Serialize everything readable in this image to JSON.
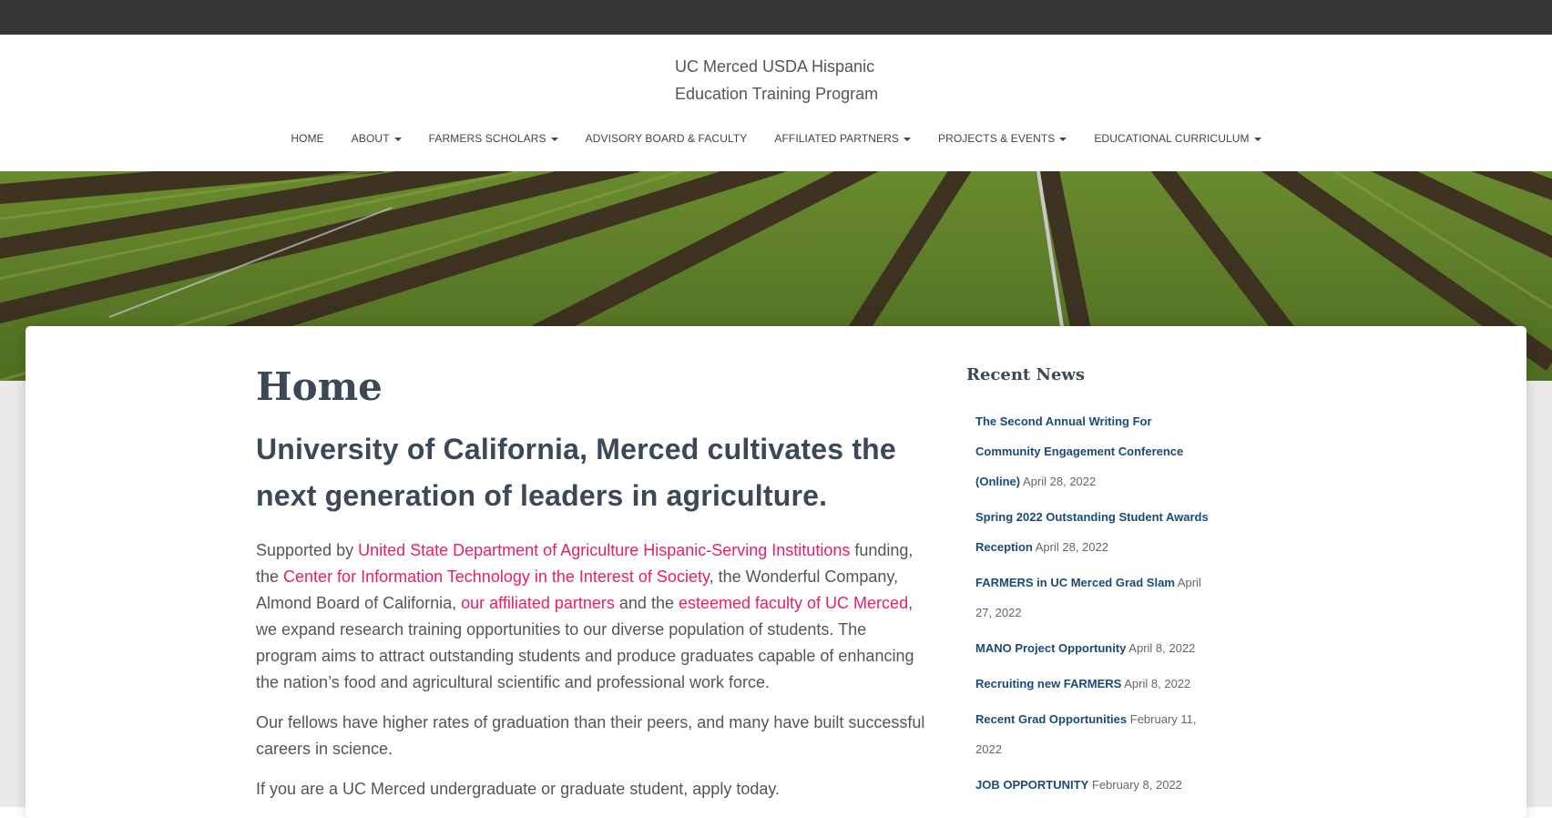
{
  "site": {
    "title_line1": "UC Merced USDA Hispanic",
    "title_line2": "Education Training Program"
  },
  "nav": {
    "items": [
      {
        "label": "HOME",
        "dropdown": false
      },
      {
        "label": "ABOUT",
        "dropdown": true
      },
      {
        "label": "FARMERS SCHOLARS",
        "dropdown": true
      },
      {
        "label": "ADVISORY BOARD & FACULTY",
        "dropdown": false
      },
      {
        "label": "AFFILIATED PARTNERS",
        "dropdown": true
      },
      {
        "label": "PROJECTS & EVENTS",
        "dropdown": true
      },
      {
        "label": "EDUCATIONAL CURRICULUM",
        "dropdown": true
      }
    ]
  },
  "main": {
    "page_title": "Home",
    "headline": "University of California, Merced cultivates the next generation of leaders in agriculture.",
    "p1": {
      "t1": "Supported by ",
      "link1": "United State Department of Agriculture Hispanic-Serving Institutions",
      "t2": " funding, the ",
      "link2": "Center for Information Technology in the Interest of Society",
      "t3": ", the Wonderful Company, Almond Board of California, ",
      "link3": "our affiliated partners",
      "t4": " and the ",
      "link4": "esteemed faculty of UC Merced",
      "t5": ", we expand research training opportunities to our diverse population of students. The program aims to attract outstanding students and produce graduates capable of enhancing the nation’s food and agricultural scientific and professional work force."
    },
    "p2": "Our fellows have higher rates of graduation than their peers, and many have built successful careers in science.",
    "p3": "If you are a UC Merced undergraduate or graduate student, apply today."
  },
  "sidebar": {
    "title": "Recent News",
    "items": [
      {
        "title": "The Second Annual Writing For Community Engagement Conference (Online)",
        "date": "April 28, 2022"
      },
      {
        "title": "Spring 2022 Outstanding Student Awards Reception",
        "date": "April 28, 2022"
      },
      {
        "title": "FARMERS in UC Merced Grad Slam",
        "date": "April 27, 2022"
      },
      {
        "title": "MANO Project Opportunity",
        "date": "April 8, 2022"
      },
      {
        "title": "Recruiting new FARMERS",
        "date": "April 8, 2022"
      },
      {
        "title": "Recent Grad Opportunities",
        "date": "February 11, 2022"
      },
      {
        "title": "JOB OPPORTUNITY",
        "date": "February 8, 2022"
      }
    ]
  },
  "colors": {
    "adminbar": "#363639",
    "link": "#e91e63",
    "news_link": "#1b4a79",
    "heading": "#3c4858"
  }
}
